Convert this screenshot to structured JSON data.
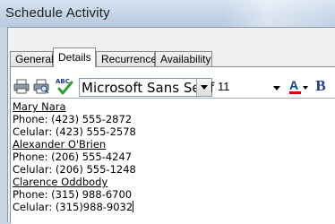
{
  "window": {
    "title": "Schedule Activity"
  },
  "tabs": [
    {
      "label": "General"
    },
    {
      "label": "Details"
    },
    {
      "label": "Recurrence"
    },
    {
      "label": "Availability"
    }
  ],
  "active_tab": "Details",
  "toolbar": {
    "font_name": "Microsoft Sans Serif",
    "font_size": "11",
    "color_button_letter": "A",
    "bold_button_letter": "B",
    "icons": [
      "print-icon",
      "print-preview-icon",
      "spell-check-icon",
      "font-color-icon",
      "bold-icon"
    ],
    "spell_icon_text": "ABC"
  },
  "contacts": [
    {
      "name": "Mary Nara",
      "phone": "Phone: (423) 555-2872",
      "cell": "Celular: (423) 555-2578"
    },
    {
      "name": "Alexander O'Brien",
      "phone": "Phone: (206) 555-4247",
      "cell": "Celular: (206) 555-1248"
    },
    {
      "name": "Clarence Oddbody",
      "phone": "Phone: (315) 988-6700",
      "cell": "Celular: (315)988-9032"
    }
  ],
  "colors": {
    "font_color_bar": "#e00000",
    "accent": "#1e3a8a"
  }
}
